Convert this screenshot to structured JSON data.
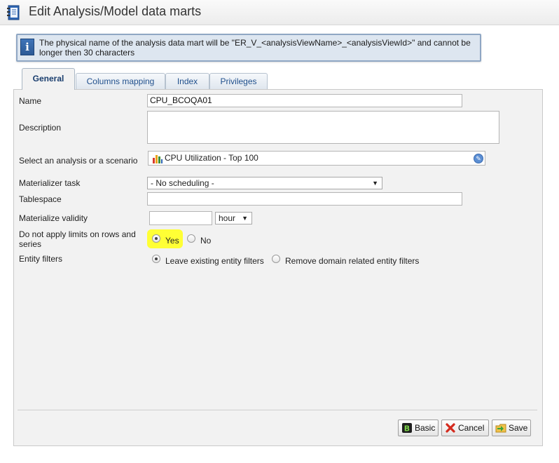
{
  "window": {
    "title": "Edit Analysis/Model data marts",
    "icon": "notebook-icon"
  },
  "info": {
    "icon": "info-icon",
    "glyph": "i",
    "message": "The physical name of the analysis data mart will be \"ER_V_<analysisViewName>_<analysisViewId>\" and cannot be longer then 30 characters"
  },
  "tabs": [
    {
      "label": "General",
      "active": true
    },
    {
      "label": "Columns mapping",
      "active": false
    },
    {
      "label": "Index",
      "active": false
    },
    {
      "label": "Privileges",
      "active": false
    }
  ],
  "form": {
    "name": {
      "label": "Name",
      "value": "CPU_BCOQA01"
    },
    "description": {
      "label": "Description",
      "value": ""
    },
    "analysis": {
      "label": "Select an analysis or a scenario",
      "value": "CPU Utilization - Top 100",
      "icon": "bar-chart-icon",
      "action_icon": "edit-icon"
    },
    "materializer": {
      "label": "Materializer task",
      "value": "- No scheduling -"
    },
    "tablespace": {
      "label": "Tablespace",
      "value": ""
    },
    "validity": {
      "label": "Materialize validity",
      "value": "",
      "unit": "hour"
    },
    "limits": {
      "label": "Do not apply limits on rows and series",
      "options": [
        "Yes",
        "No"
      ],
      "selected": "Yes",
      "highlight_color": "#ffff35"
    },
    "entity_filters": {
      "label": "Entity filters",
      "options": [
        "Leave existing entity filters",
        "Remove domain related entity filters"
      ],
      "selected": "Leave existing entity filters"
    }
  },
  "buttons": {
    "basic": {
      "label": "Basic",
      "icon": "basic-b-icon"
    },
    "cancel": {
      "label": "Cancel",
      "icon": "red-x-icon"
    },
    "save": {
      "label": "Save",
      "icon": "save-folder-icon"
    }
  },
  "colors": {
    "tab_text": "#1f4f8c",
    "info_bg": "#dde6f0",
    "info_border": "#8fa7c4",
    "panel_bg": "#f2f2f2"
  }
}
